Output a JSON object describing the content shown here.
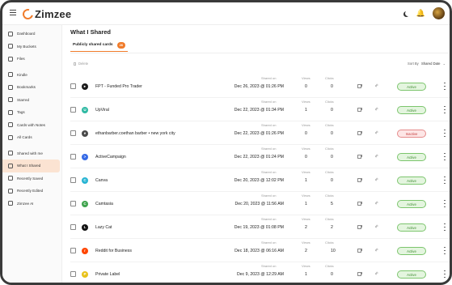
{
  "app": {
    "name": "Zimzee"
  },
  "sidebar": {
    "items": [
      {
        "label": "Dashboard",
        "icon": "dashboard-icon"
      },
      {
        "label": "My Buckets",
        "icon": "bucket-icon"
      },
      {
        "label": "Files",
        "icon": "folder-icon"
      },
      {
        "label": "Kindle",
        "icon": "book-icon"
      },
      {
        "label": "Bookmarks",
        "icon": "bookmark-icon"
      },
      {
        "label": "Starred",
        "icon": "star-icon"
      },
      {
        "label": "Tags",
        "icon": "tag-icon"
      },
      {
        "label": "Cards with Notes",
        "icon": "note-icon"
      },
      {
        "label": "All Cards",
        "icon": "cards-icon"
      },
      {
        "label": "Shared with me",
        "icon": "share-in-icon"
      },
      {
        "label": "What I Shared",
        "icon": "share-out-icon",
        "active": true
      },
      {
        "label": "Recently Saved",
        "icon": "clock-icon"
      },
      {
        "label": "Recently Edited",
        "icon": "edit-icon"
      },
      {
        "label": "Zimzee AI",
        "icon": "ai-icon"
      }
    ]
  },
  "main": {
    "title": "What I Shared",
    "tab": {
      "label": "Publicly shared cards",
      "count": "26"
    },
    "toolbar": {
      "delete_label": "Delete",
      "sort_label": "Sort By",
      "sort_value": "Shared Date"
    },
    "columns": {
      "shared_on": "Shared on",
      "views": "Views",
      "clicks": "Clicks"
    },
    "rows": [
      {
        "title": "FPT - Funded Pro Trader",
        "shared_on": "Dec 26, 2023 @ 01:26 PM",
        "views": "0",
        "clicks": "0",
        "status": "Active",
        "favicon_color": "#1a1a1a",
        "favicon_glyph": "▸"
      },
      {
        "title": "UpViral",
        "shared_on": "Dec 22, 2023 @ 01:34 PM",
        "views": "1",
        "clicks": "0",
        "status": "Active",
        "favicon_color": "#2fb9a3",
        "favicon_glyph": "U"
      },
      {
        "title": "ethanbarber.coethan barber • new york city",
        "shared_on": "Dec 22, 2023 @ 01:26 PM",
        "views": "0",
        "clicks": "0",
        "status": "Inactive",
        "favicon_color": "#4a4a4a",
        "favicon_glyph": "e"
      },
      {
        "title": "ActiveCampaign",
        "shared_on": "Dec 22, 2023 @ 01:24 PM",
        "views": "0",
        "clicks": "0",
        "status": "Active",
        "favicon_color": "#356ae6",
        "favicon_glyph": ">"
      },
      {
        "title": "Canva",
        "shared_on": "Dec 20, 2023 @ 12:02 PM",
        "views": "1",
        "clicks": "0",
        "status": "Active",
        "favicon_color": "#27b4d3",
        "favicon_glyph": "C"
      },
      {
        "title": "Camtasia",
        "shared_on": "Dec 20, 2023 @ 11:56 AM",
        "views": "1",
        "clicks": "5",
        "status": "Active",
        "favicon_color": "#3fa34d",
        "favicon_glyph": "C"
      },
      {
        "title": "Lazy Cat",
        "shared_on": "Dec 19, 2023 @ 01:08 PM",
        "views": "2",
        "clicks": "2",
        "status": "Active",
        "favicon_color": "#111111",
        "favicon_glyph": "L"
      },
      {
        "title": "Reddit for Business",
        "shared_on": "Dec 18, 2023 @ 06:16 AM",
        "views": "2",
        "clicks": "10",
        "status": "Active",
        "favicon_color": "#ff4500",
        "favicon_glyph": "r"
      },
      {
        "title": "Private Label",
        "shared_on": "Dec 9, 2023 @ 12:29 AM",
        "views": "1",
        "clicks": "0",
        "status": "Active",
        "favicon_color": "#e8c21a",
        "favicon_glyph": "P"
      }
    ]
  },
  "colors": {
    "accent": "#f07b2a",
    "active": "#3a8a2d",
    "inactive": "#c43b3b"
  }
}
